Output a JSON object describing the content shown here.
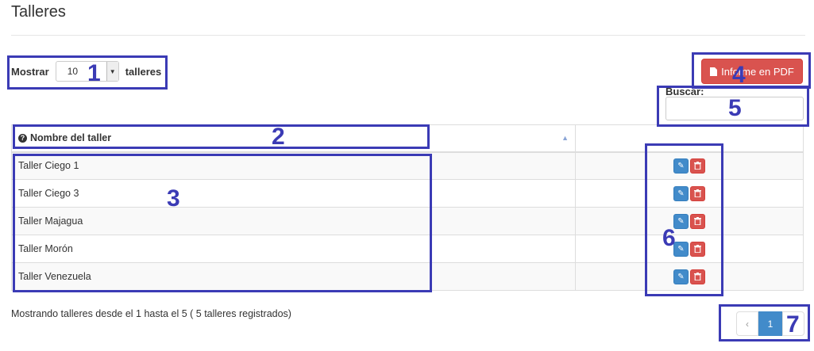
{
  "page": {
    "title": "Talleres"
  },
  "length_menu": {
    "prefix": "Mostrar",
    "value": "10",
    "suffix": "talleres"
  },
  "pdf_button": {
    "label": "Informe en PDF"
  },
  "search": {
    "label": "Buscar:",
    "value": ""
  },
  "table": {
    "column_header": "Nombre del taller",
    "rows": [
      {
        "name": "Taller Ciego 1"
      },
      {
        "name": "Taller Ciego 3"
      },
      {
        "name": "Taller Majagua"
      },
      {
        "name": "Taller Morón"
      },
      {
        "name": "Taller Venezuela"
      }
    ]
  },
  "info": "Mostrando talleres desde el 1 hasta el 5 ( 5 talleres registrados)",
  "pagination": {
    "prev": "‹",
    "current": "1",
    "next": "›"
  },
  "annotations": [
    "1",
    "2",
    "3",
    "4",
    "5",
    "6",
    "7"
  ],
  "colors": {
    "primary": "#428bca",
    "danger": "#d9534f",
    "annotation": "#3b3bb5"
  },
  "icons": {
    "edit": "pencil-icon",
    "delete": "trash-icon",
    "pdf": "file-icon",
    "header": "question-circle-icon",
    "sort": "sort-asc-icon"
  }
}
